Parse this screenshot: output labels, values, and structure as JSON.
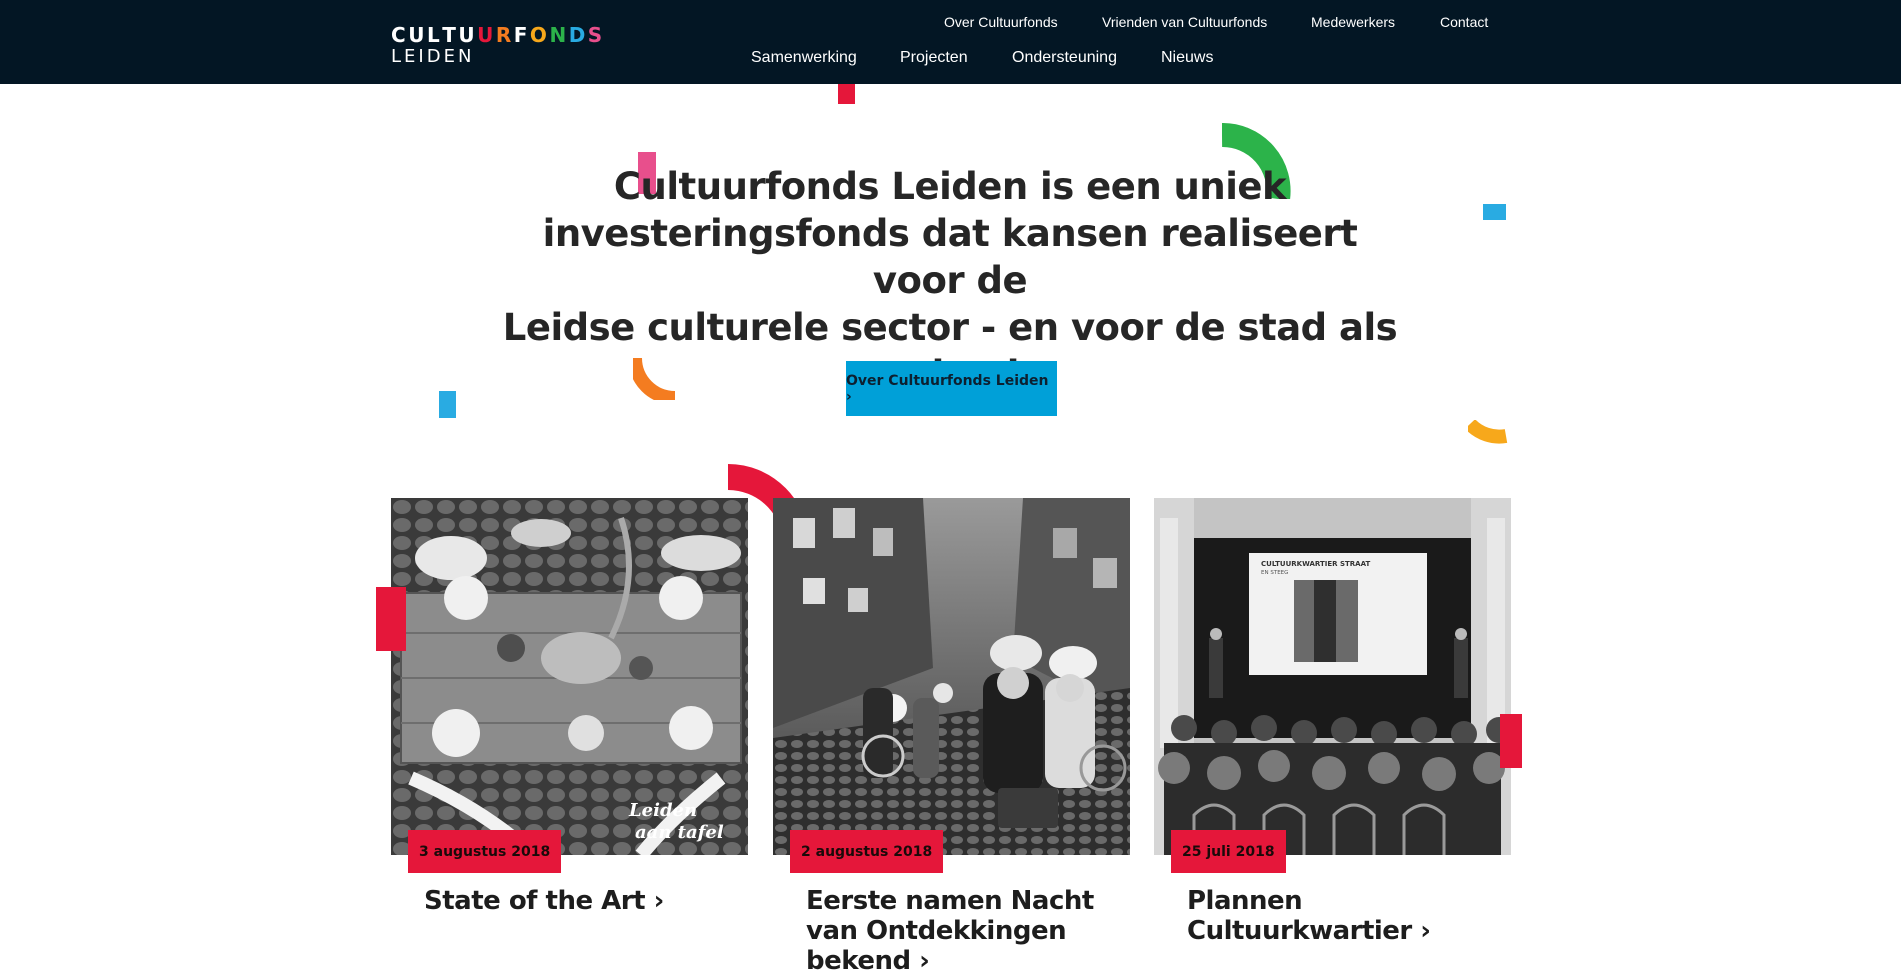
{
  "header": {
    "logo": {
      "word_top_letters": [
        {
          "ch": "C",
          "color": "#ffffff"
        },
        {
          "ch": "U",
          "color": "#ffffff"
        },
        {
          "ch": "L",
          "color": "#ffffff"
        },
        {
          "ch": "T",
          "color": "#ffffff"
        },
        {
          "ch": "U",
          "color": "#ffffff"
        },
        {
          "ch": "U",
          "color": "#e5173a"
        },
        {
          "ch": "R",
          "color": "#f47c20"
        },
        {
          "ch": "F",
          "color": "#ffffff"
        },
        {
          "ch": "O",
          "color": "#f7a81b"
        },
        {
          "ch": "N",
          "color": "#2cb34a"
        },
        {
          "ch": "D",
          "color": "#29abe2"
        },
        {
          "ch": "S",
          "color": "#e84f8c"
        }
      ],
      "word_bottom": "LEIDEN"
    },
    "top_nav": [
      "Over Cultuurfonds",
      "Vrienden van Cultuurfonds",
      "Medewerkers",
      "Contact"
    ],
    "main_nav": [
      "Samenwerking",
      "Projecten",
      "Ondersteuning",
      "Nieuws"
    ]
  },
  "hero": {
    "title_lines": [
      "Cultuurfonds Leiden is een uniek",
      "investeringsfonds dat kansen realiseert voor de",
      "Leidse culturele sector - en voor de stad als",
      "geheel"
    ],
    "cta_label": "Over Cultuurfonds Leiden ›"
  },
  "news": [
    {
      "date": "3 augustus 2018",
      "title_lines": [
        "State of the Art ›"
      ],
      "image_overlay_text": [
        "Leiden",
        "aan tafel"
      ]
    },
    {
      "date": "2 augustus 2018",
      "title_lines": [
        "Eerste namen Nacht",
        "van Ontdekkingen",
        "bekend ›"
      ]
    },
    {
      "date": "25 juli 2018",
      "title_lines": [
        "Plannen",
        "Cultuurkwartier ›"
      ],
      "screen_text": [
        "CULTUURKWARTIER STRAAT",
        "EN STEEG"
      ]
    }
  ],
  "colors": {
    "header_bg": "#031624",
    "cta_bg": "#00a0d8",
    "badge_bg": "#e5173a",
    "accent_red": "#e5173a",
    "accent_green": "#2cb34a",
    "accent_orange": "#f47c20",
    "accent_yellow": "#f7a81b",
    "accent_blue": "#29abe2",
    "accent_pink": "#e84f8c"
  }
}
